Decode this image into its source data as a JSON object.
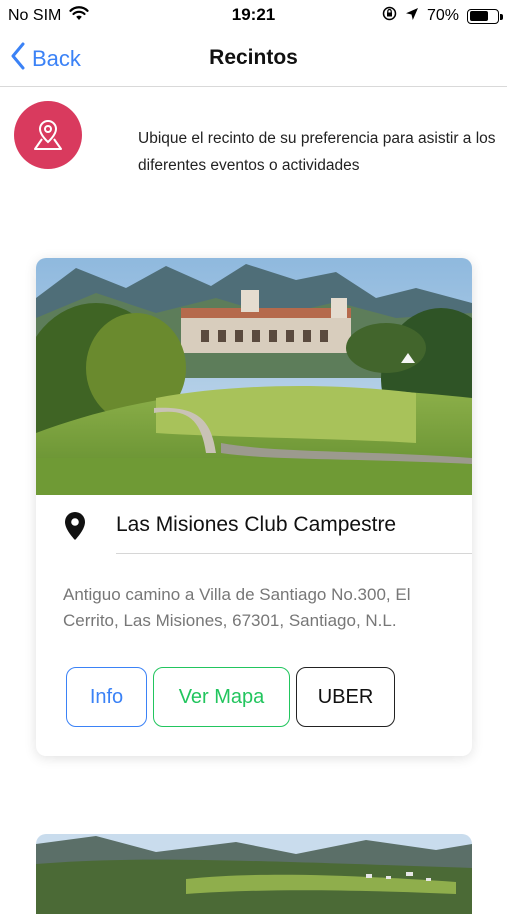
{
  "status_bar": {
    "carrier": "No SIM",
    "time": "19:21",
    "battery_percent_text": "70%",
    "battery_level": 0.7,
    "icons": [
      "wifi-icon",
      "orientation-lock-icon",
      "location-arrow-icon",
      "battery-icon"
    ]
  },
  "nav": {
    "back_label": "Back",
    "title": "Recintos"
  },
  "intro": {
    "icon": "map-pin-icon",
    "accent_color": "#d93a5e",
    "text": "Ubique el recinto de su preferencia para asistir a los diferentes eventos o actividades"
  },
  "venues": [
    {
      "name": "Las Misiones Club Campestre",
      "address": "Antiguo camino a Villa de Santiago No.300, El Cerrito, Las Misiones, 67301, Santiago, N.L.",
      "icon": "location-pin-icon",
      "buttons": {
        "info": "Info",
        "map": "Ver Mapa",
        "uber": "UBER"
      }
    }
  ],
  "colors": {
    "link_blue": "#3b82f6",
    "map_green": "#22c55e",
    "uber_dark": "#222222"
  }
}
